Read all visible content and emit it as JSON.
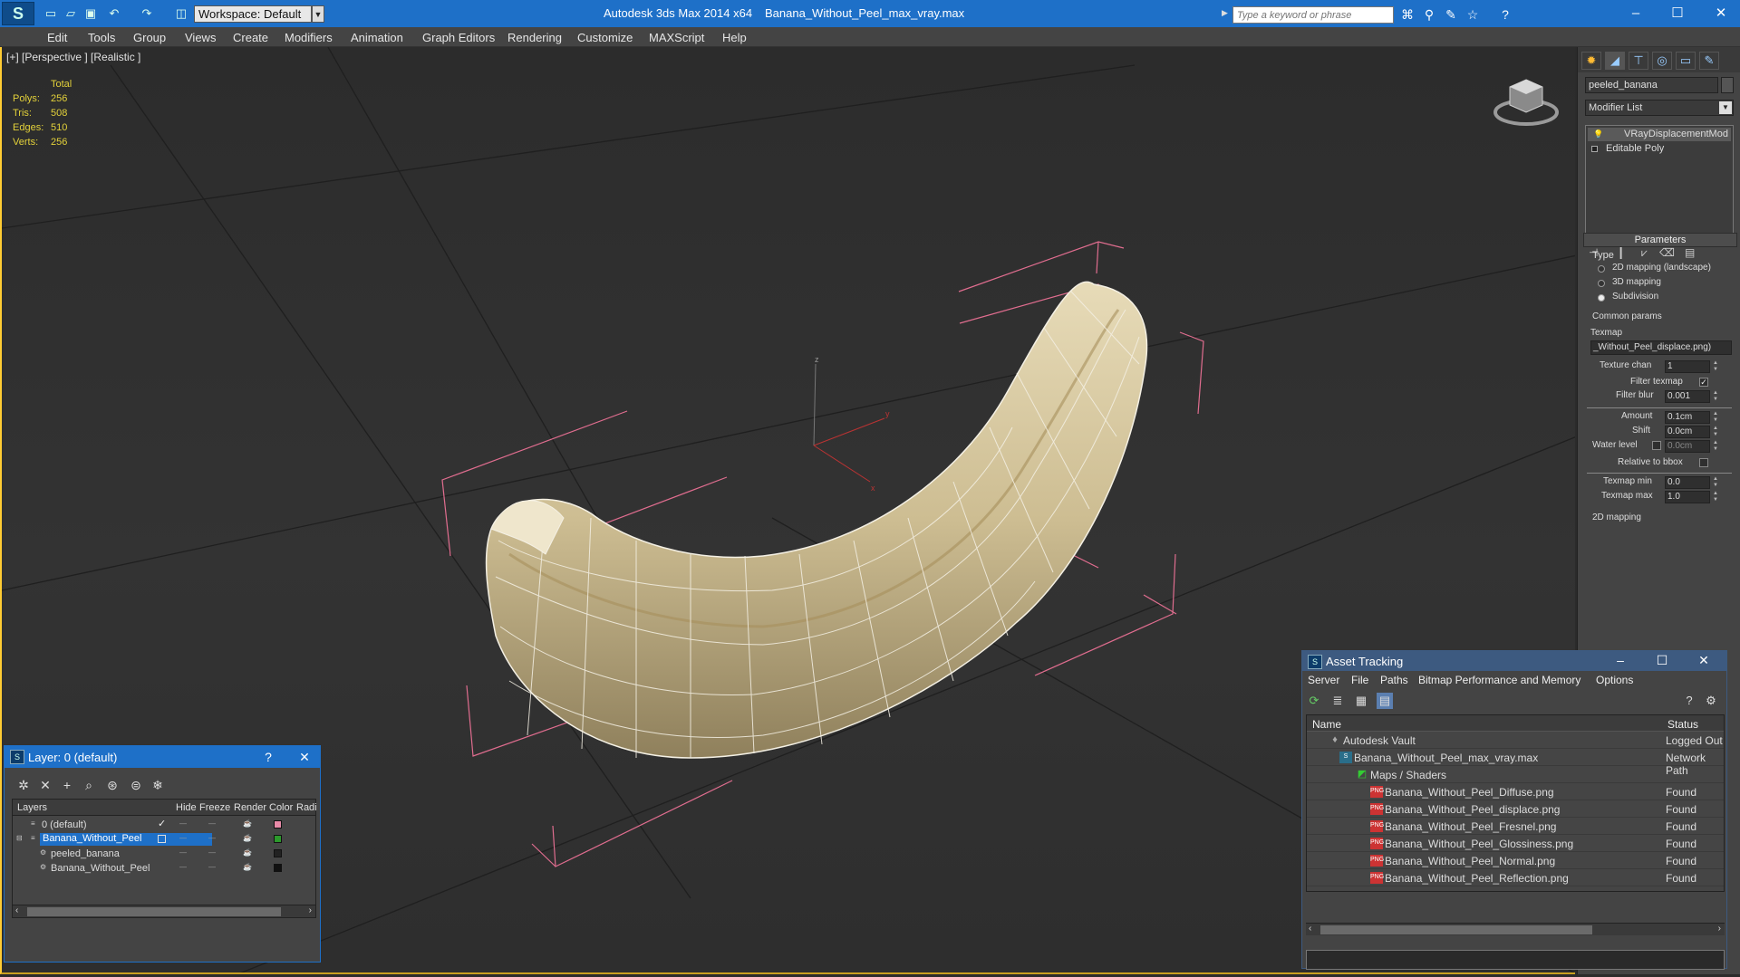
{
  "app": {
    "title": "Autodesk 3ds Max  2014 x64",
    "file": "Banana_Without_Peel_max_vray.max",
    "workspace": "Workspace: Default",
    "search_placeholder": "Type a keyword or phrase",
    "accent_color": "#1e70c8"
  },
  "quick_access_icons": [
    "new-file-icon",
    "open-file-icon",
    "save-icon",
    "undo-icon",
    "redo-icon",
    "project-folder-icon"
  ],
  "toolbar_icons": [
    "binoculars-icon",
    "search-icon",
    "communication-icon",
    "favorites-icon",
    "help-icon"
  ],
  "menu": [
    "Edit",
    "Tools",
    "Group",
    "Views",
    "Create",
    "Modifiers",
    "Animation",
    "Graph Editors",
    "Rendering",
    "Customize",
    "MAXScript",
    "Help"
  ],
  "viewport": {
    "label": "[+] [Perspective ] [Realistic ]",
    "stats": {
      "header": "Total",
      "polys_label": "Polys:",
      "polys": "256",
      "tris_label": "Tris:",
      "tris": "508",
      "edges_label": "Edges:",
      "edges": "510",
      "verts_label": "Verts:",
      "verts": "256"
    },
    "gizmo": {
      "z": "z",
      "y": "y",
      "x": "x"
    }
  },
  "command_panel": {
    "tabs": [
      "create-icon",
      "modify-icon",
      "hierarchy-icon",
      "motion-icon",
      "display-icon",
      "utilities-icon"
    ],
    "object_name": "peeled_banana",
    "modifier_list": "Modifier List",
    "stack": [
      "VRayDisplacementMod",
      "Editable Poly"
    ],
    "parameters": {
      "header": "Parameters",
      "type_label": "Type",
      "type_options": [
        "2D mapping (landscape)",
        "3D mapping",
        "Subdivision"
      ],
      "selected_type": "Subdivision",
      "common_params": "Common params",
      "texmap_label": "Texmap",
      "texmap_value": "_Without_Peel_displace.png)",
      "texture_chan_label": "Texture chan",
      "texture_chan": "1",
      "filter_texmap_label": "Filter texmap",
      "filter_texmap": true,
      "filter_blur_label": "Filter blur",
      "filter_blur": "0.001",
      "amount_label": "Amount",
      "amount": "0.1cm",
      "shift_label": "Shift",
      "shift": "0.0cm",
      "water_level_label": "Water level",
      "water_level": "0.0cm",
      "relative_label": "Relative to bbox",
      "texmap_min_label": "Texmap min",
      "texmap_min": "0.0",
      "texmap_max_label": "Texmap max",
      "texmap_max": "1.0",
      "mapping_2d": "2D mapping"
    }
  },
  "layer_dialog": {
    "title": "Layer: 0 (default)",
    "help": "?",
    "close": "✕",
    "columns": [
      "Layers",
      "Hide",
      "Freeze",
      "Render",
      "Color",
      "Radi"
    ],
    "rows": [
      {
        "name": "0 (default)",
        "swatch": "#e88aa8"
      },
      {
        "name": "Banana_Without_Peel",
        "swatch": "#2c9a2c"
      },
      {
        "name": "peeled_banana",
        "swatch": "#222222"
      },
      {
        "name": "Banana_Without_Peel",
        "swatch": "#111111"
      }
    ]
  },
  "asset_tracking": {
    "title": "Asset Tracking",
    "menu": [
      "Server",
      "File",
      "Paths",
      "Bitmap Performance and Memory",
      "Options"
    ],
    "columns": [
      "Name",
      "Status"
    ],
    "rows": [
      {
        "name": "Autodesk Vault",
        "status": "Logged Out",
        "icon": "vault-icon"
      },
      {
        "name": "Banana_Without_Peel_max_vray.max",
        "status": "Network Path",
        "icon": "max-file-icon"
      },
      {
        "name": "Maps / Shaders",
        "status": "",
        "icon": "maps-icon"
      },
      {
        "name": "Banana_Without_Peel_Diffuse.png",
        "status": "Found",
        "icon": "png-icon"
      },
      {
        "name": "Banana_Without_Peel_displace.png",
        "status": "Found",
        "icon": "png-icon"
      },
      {
        "name": "Banana_Without_Peel_Fresnel.png",
        "status": "Found",
        "icon": "png-icon"
      },
      {
        "name": "Banana_Without_Peel_Glossiness.png",
        "status": "Found",
        "icon": "png-icon"
      },
      {
        "name": "Banana_Without_Peel_Normal.png",
        "status": "Found",
        "icon": "png-icon"
      },
      {
        "name": "Banana_Without_Peel_Reflection.png",
        "status": "Found",
        "icon": "png-icon"
      }
    ]
  }
}
